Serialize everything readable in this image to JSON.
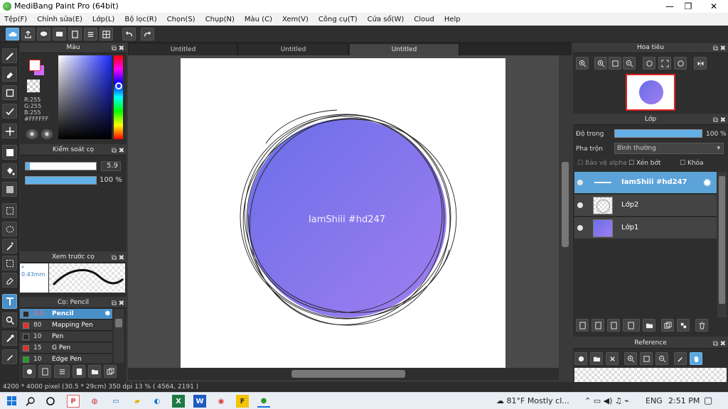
{
  "window": {
    "title": "MediBang Paint Pro (64bit)",
    "minimize": "—",
    "maximize": "❐",
    "close": "✕"
  },
  "menu": [
    "Tệp(F)",
    "Chỉnh sửa(E)",
    "Lớp(L)",
    "Bộ lọc(R)",
    "Chọn(S)",
    "Chụp(N)",
    "Màu (C)",
    "Xem(V)",
    "Công cụ(T)",
    "Cửa sổ(W)",
    "Cloud",
    "Help"
  ],
  "tabs": [
    "Untitled",
    "Untitled",
    "Untitled"
  ],
  "color_panel": {
    "title": "Màu",
    "r": "R:255",
    "g": "G:255",
    "b": "B:255",
    "hex": "#FFFFFF",
    "fg_color": "#ffffff",
    "bg_color": "#cc6cff"
  },
  "brush_control": {
    "title": "Kiểm soát cọ",
    "size": "5.9",
    "opacity": "100 %",
    "size_fraction": 0.06,
    "opacity_fraction": 1.0
  },
  "brush_preview": {
    "title": "Xem trước cọ",
    "size_label": "* 0.43mm"
  },
  "brush_list": {
    "title": "Cọ: Pencil",
    "items": [
      {
        "size": "5.9",
        "name": "Pencil",
        "color": "#2a2a2a",
        "selected": true
      },
      {
        "size": "80",
        "name": "Mapping Pen",
        "color": "#e03030",
        "selected": false
      },
      {
        "size": "10",
        "name": "Pen",
        "color": "#2a2a2a",
        "selected": false
      },
      {
        "size": "15",
        "name": "G Pen",
        "color": "#e03030",
        "selected": false
      },
      {
        "size": "10",
        "name": "Edge Pen",
        "color": "#22a022",
        "selected": false
      }
    ]
  },
  "canvas": {
    "text": "IamShiii #hd247",
    "circle_from": "#6a6ee8",
    "circle_to": "#a07ef0"
  },
  "status": {
    "text": "4200 * 4000 pixel   (30.5 * 29cm)   350 dpi   13 %   ( 4564, 2191 )"
  },
  "navigator": {
    "title": "Hoa tiêu"
  },
  "layers": {
    "title": "Lớp",
    "opacity_label": "Độ trong",
    "opacity_value": "100 %",
    "blend_label": "Pha trộn",
    "blend_value": "Bình thường",
    "protect_alpha": "Bảo vệ alpha",
    "clip": "Xén bớt",
    "lock": "Khóa",
    "items": [
      {
        "name": "IamShiii #hd247",
        "selected": true
      },
      {
        "name": "Lớp2",
        "selected": false
      },
      {
        "name": "Lớp1",
        "selected": false
      }
    ]
  },
  "reference": {
    "title": "Reference"
  },
  "taskbar": {
    "weather": "81°F  Mostly cl...",
    "lang": "ENG",
    "time": "2:51 PM"
  }
}
